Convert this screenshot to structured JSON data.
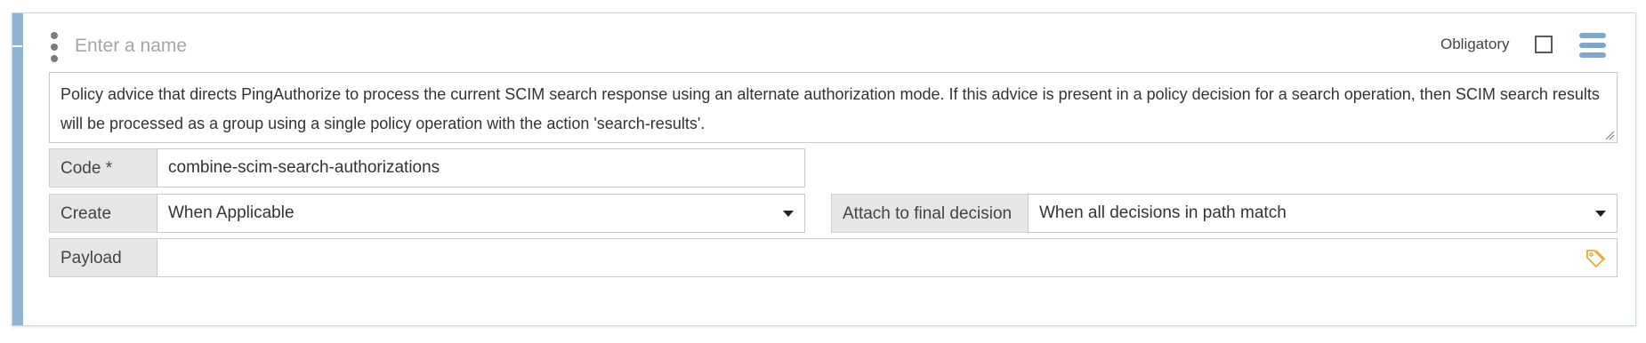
{
  "header": {
    "name_placeholder": "Enter a name",
    "obligatory_label": "Obligatory",
    "obligatory_checked": false
  },
  "description": "Policy advice that directs PingAuthorize to process the current SCIM search response using an alternate authorization mode. If this advice is present in a policy decision for a search operation, then SCIM search results will be processed as a group using a single policy operation with the action 'search-results'.",
  "code": {
    "label": "Code *",
    "value": "combine-scim-search-authorizations"
  },
  "create": {
    "label": "Create",
    "selected": "When Applicable"
  },
  "attach": {
    "label": "Attach to final decision",
    "selected": "When all decisions in path match"
  },
  "payload": {
    "label": "Payload",
    "value": ""
  },
  "icons": {
    "drag": "drag-handle-icon",
    "menu": "hamburger-menu-icon",
    "tag": "tag-icon",
    "caret": "chevron-down-icon"
  },
  "colors": {
    "accent": "#8fb3d3",
    "menu_icon": "#7fa6cb",
    "tag_icon": "#f0a830",
    "label_bg": "#e6e6e6"
  }
}
